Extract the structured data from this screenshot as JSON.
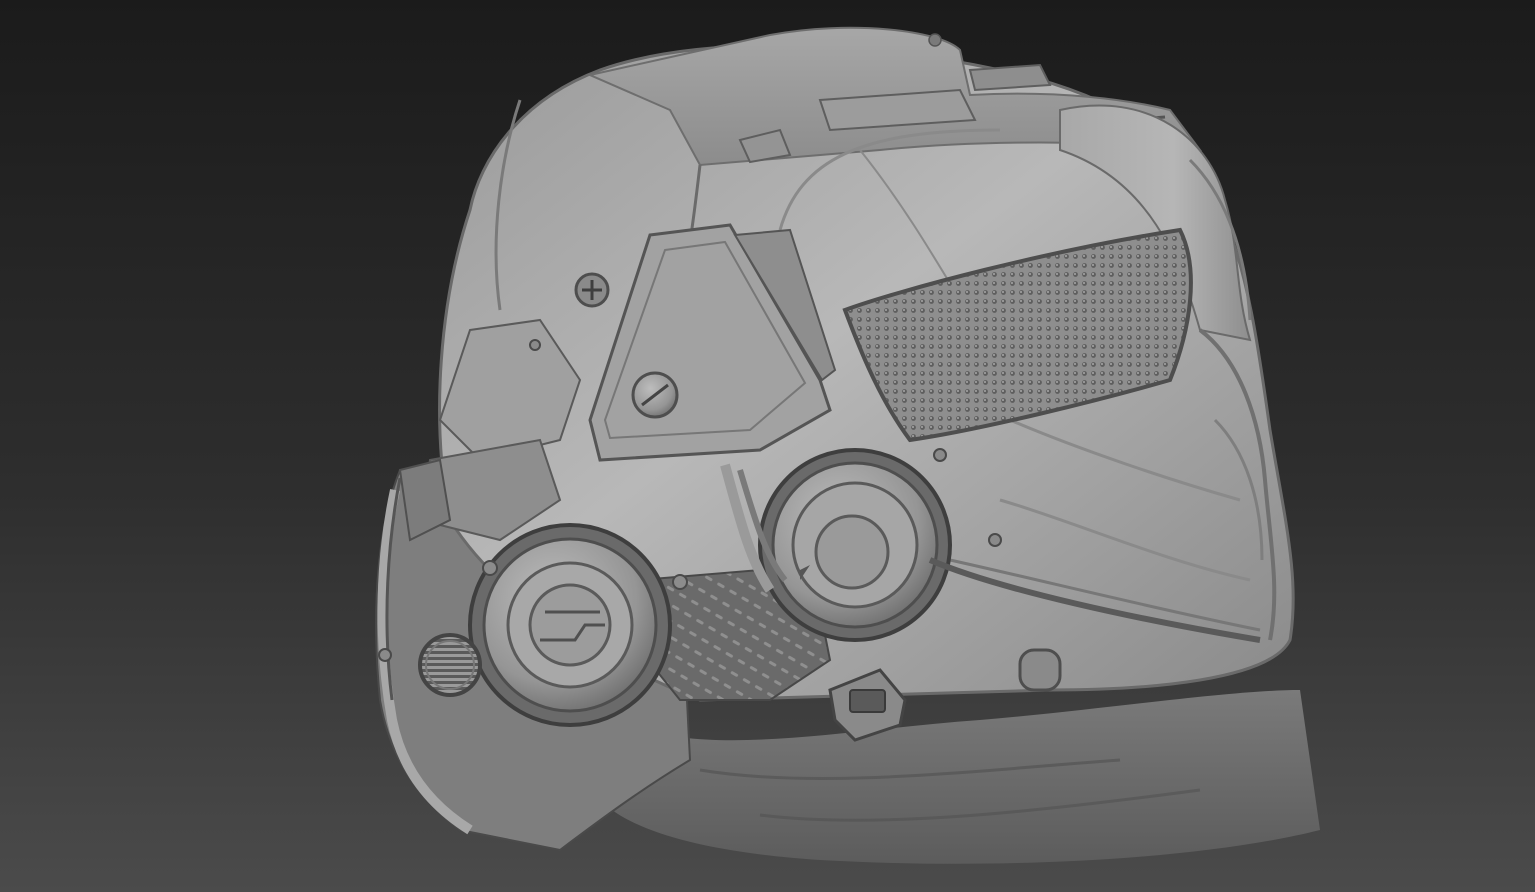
{
  "scene": {
    "subject": "helmet-sculpt",
    "view": "three-quarter-side",
    "material": "gray-clay",
    "colors": {
      "background_top": "#1c1c1c",
      "background_bottom": "#4a4a4a",
      "shell_light": "#b4b4b4",
      "shell_mid": "#8a8a8a",
      "shell_dark": "#5a5a5a",
      "shadow": "#3a3a3a",
      "mesh": "#6e6e6e"
    }
  }
}
